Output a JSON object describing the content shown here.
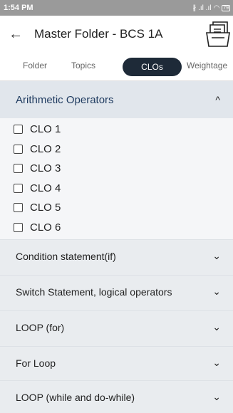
{
  "status_bar": {
    "time": "1:54 PM",
    "signal": "∦ .ıl .ıl",
    "wifi": "◠",
    "battery": "79"
  },
  "app_bar": {
    "back_icon": "←",
    "title": "Master Folder - BCS 1A"
  },
  "tabs": [
    {
      "label": "Folder",
      "active": false
    },
    {
      "label": "Topics",
      "active": false
    },
    {
      "label": "CLOs",
      "active": true
    },
    {
      "label": "Weightage",
      "active": false
    }
  ],
  "expanded_topic": {
    "title": "Arithmetic Operators",
    "chevron": "^"
  },
  "clos": [
    {
      "label": "CLO 1",
      "checked": false
    },
    {
      "label": "CLO 2",
      "checked": false
    },
    {
      "label": "CLO 3",
      "checked": false
    },
    {
      "label": "CLO 4",
      "checked": false
    },
    {
      "label": "CLO 5",
      "checked": false
    },
    {
      "label": "CLO 6",
      "checked": false
    }
  ],
  "collapsed_topics": [
    {
      "title": "Condition statement(if)",
      "chevron": "⌄"
    },
    {
      "title": "Switch Statement, logical operators",
      "chevron": "⌄"
    },
    {
      "title": "LOOP (for)",
      "chevron": "⌄"
    },
    {
      "title": "For Loop",
      "chevron": "⌄"
    },
    {
      "title": "LOOP (while and do-while)",
      "chevron": "⌄"
    }
  ],
  "colors": {
    "active_tab": "#1e2a38",
    "topic_title": "#1e3a5f",
    "status_bar": "#9a9a9a"
  }
}
